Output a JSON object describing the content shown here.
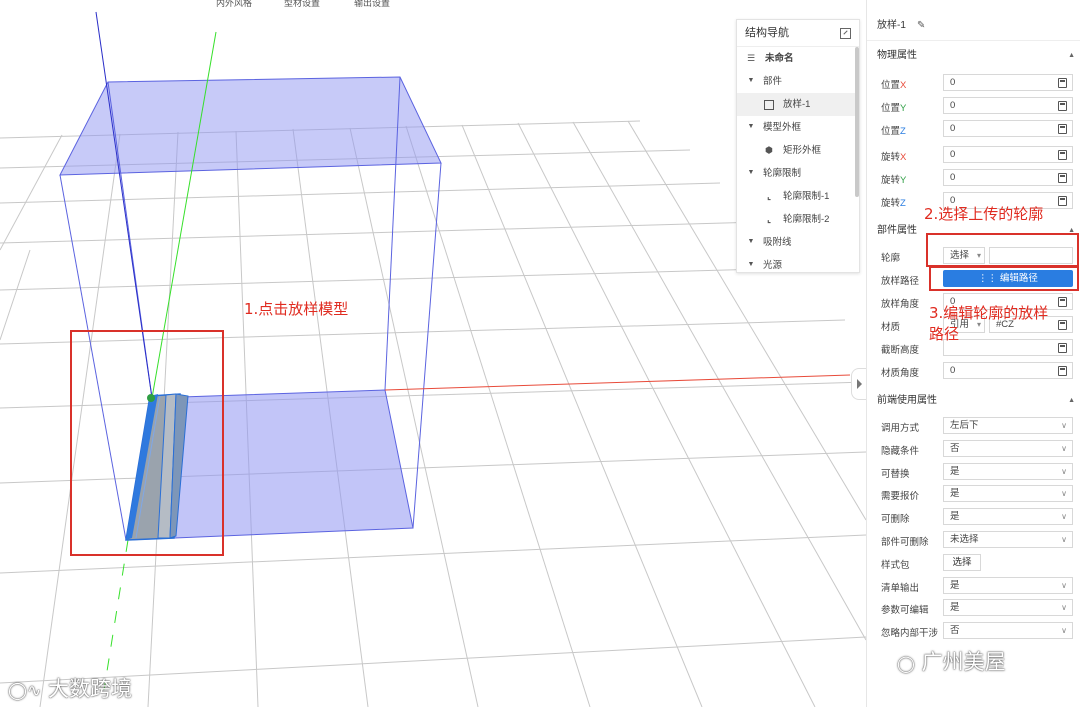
{
  "topbar": {
    "items": [
      "内外风格",
      "型材设置",
      "输出设置"
    ]
  },
  "annotations": {
    "step1": "1.点击放样模型",
    "step2": "2.选择上传的轮廓",
    "step3_line1": "3.编辑轮廓的放样",
    "step3_line2": "路径"
  },
  "nav": {
    "title": "结构导航",
    "items": [
      {
        "label": "未命名",
        "icon": "layers-icon"
      },
      {
        "label": "部件",
        "icon": "caret-down-icon"
      },
      {
        "label": "放样-1",
        "icon": "lofting-icon"
      },
      {
        "label": "模型外框",
        "icon": "caret-down-icon"
      },
      {
        "label": "矩形外框",
        "icon": "cube-icon"
      },
      {
        "label": "轮廓限制",
        "icon": "caret-down-icon"
      },
      {
        "label": "轮廓限制-1",
        "icon": "profile-icon"
      },
      {
        "label": "轮廓限制-2",
        "icon": "profile-icon"
      },
      {
        "label": "吸附线",
        "icon": "caret-down-icon"
      },
      {
        "label": "光源",
        "icon": "caret-down-icon"
      }
    ]
  },
  "props": {
    "header": "放样-1",
    "physical": {
      "title": "物理属性",
      "rows": [
        {
          "name": "位置",
          "axis": "X",
          "value": "0"
        },
        {
          "name": "位置",
          "axis": "Y",
          "value": "0"
        },
        {
          "name": "位置",
          "axis": "Z",
          "value": "0"
        },
        {
          "name": "旋转",
          "axis": "X",
          "value": "0"
        },
        {
          "name": "旋转",
          "axis": "Y",
          "value": "0"
        },
        {
          "name": "旋转",
          "axis": "Z",
          "value": "0"
        }
      ]
    },
    "part": {
      "title": "部件属性",
      "profile_label": "轮廓",
      "profile_select": "选择",
      "path_label": "放样路径",
      "path_button": "编辑路径",
      "angle_label": "放样角度",
      "angle_value": "0",
      "material_label": "材质",
      "material_mode": "引用",
      "material_value": "#CZ",
      "section_label": "截断高度",
      "section_value": "",
      "mat_angle_label": "材质角度",
      "mat_angle_value": "0"
    },
    "frontend": {
      "title": "前端使用属性",
      "rows": [
        {
          "label": "调用方式",
          "value": "左后下",
          "type": "select"
        },
        {
          "label": "隐藏条件",
          "value": "否",
          "type": "select"
        },
        {
          "label": "可替换",
          "value": "是",
          "type": "select"
        },
        {
          "label": "需要报价",
          "value": "是",
          "type": "select"
        },
        {
          "label": "可删除",
          "value": "是",
          "type": "select"
        },
        {
          "label": "部件可删除",
          "value": "未选择",
          "type": "select"
        },
        {
          "label": "样式包",
          "value": "选择",
          "type": "button"
        },
        {
          "label": "清单输出",
          "value": "是",
          "type": "select"
        },
        {
          "label": "参数可编辑",
          "value": "是",
          "type": "select"
        },
        {
          "label": "忽略内部干涉",
          "value": "否",
          "type": "select"
        }
      ]
    }
  },
  "watermarks": {
    "left": "大数跨境",
    "right": "广州美屋"
  },
  "colors": {
    "accent": "#2a7de1",
    "annotation": "#e02b20",
    "axis_x": "#e84b3a",
    "axis_y": "#2e9e44",
    "axis_z": "#2a7de1",
    "frame_fill": "#8f95f2"
  }
}
